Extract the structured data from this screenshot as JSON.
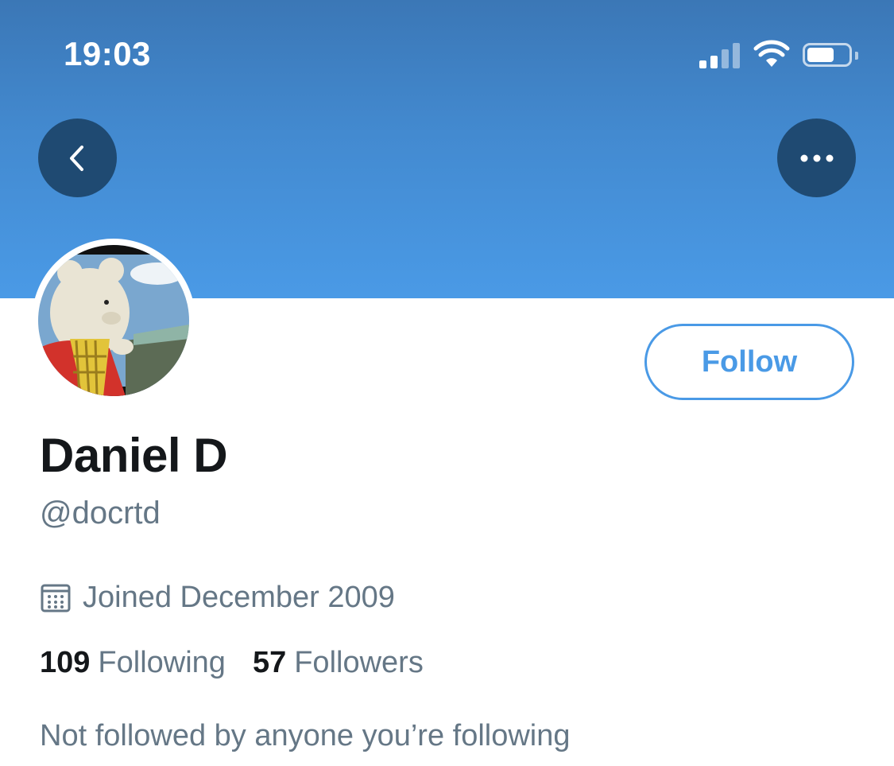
{
  "status_bar": {
    "time": "19:03"
  },
  "colors": {
    "banner": "#4a9ae6",
    "accent": "#4a9ae6",
    "nav_button": "#1f4a72",
    "secondary_text": "#657786"
  },
  "nav": {
    "back_icon": "chevron-left-icon",
    "more_icon": "more-horizontal-icon"
  },
  "profile": {
    "display_name": "Daniel D",
    "handle": "@docrtd",
    "joined": "Joined December 2009",
    "following_count": "109",
    "following_label": "Following",
    "followers_count": "57",
    "followers_label": "Followers",
    "mutuals_note": "Not followed by anyone you’re following"
  },
  "actions": {
    "follow_label": "Follow"
  }
}
